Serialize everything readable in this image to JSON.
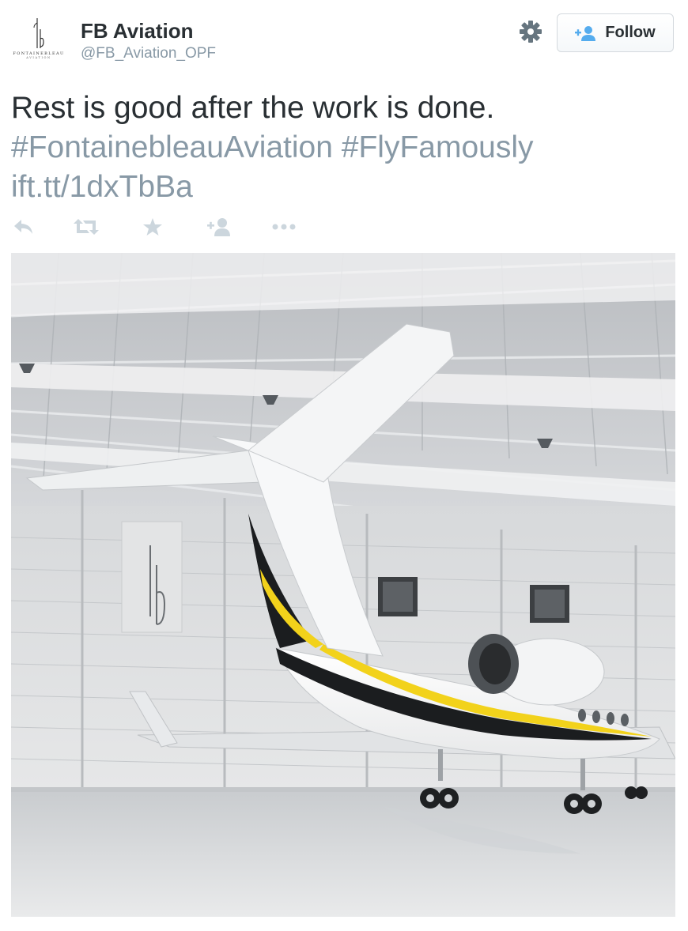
{
  "author": {
    "name": "FB Aviation",
    "handle": "@FB_Aviation_OPF",
    "avatar_brand": "FONTAINEBLEAU",
    "avatar_sub": "AVIATION"
  },
  "follow_button": {
    "label": "Follow",
    "icon": "add-user-icon"
  },
  "settings": {
    "icon": "gear-icon"
  },
  "tweet": {
    "text": "Rest is good after the work is done.",
    "hashtags": [
      "#FontainebleauAviation",
      "#FlyFamously"
    ],
    "link": "ift.tt/1dxTbBa"
  },
  "actions": [
    {
      "name": "reply",
      "icon": "reply-icon"
    },
    {
      "name": "retweet",
      "icon": "retweet-icon"
    },
    {
      "name": "favorite",
      "icon": "star-icon"
    },
    {
      "name": "follow",
      "icon": "add-user-icon"
    },
    {
      "name": "more",
      "icon": "more-dots-icon"
    }
  ],
  "media": {
    "icon": "photo-private-jet-in-hangar"
  },
  "colors": {
    "text": "#292f33",
    "muted": "#8899a6",
    "follow_icon": "#55acee",
    "action_icons": "#ccd6dd",
    "jet_stripe_yellow": "#f2d21b",
    "jet_stripe_black": "#1b1d1f"
  }
}
